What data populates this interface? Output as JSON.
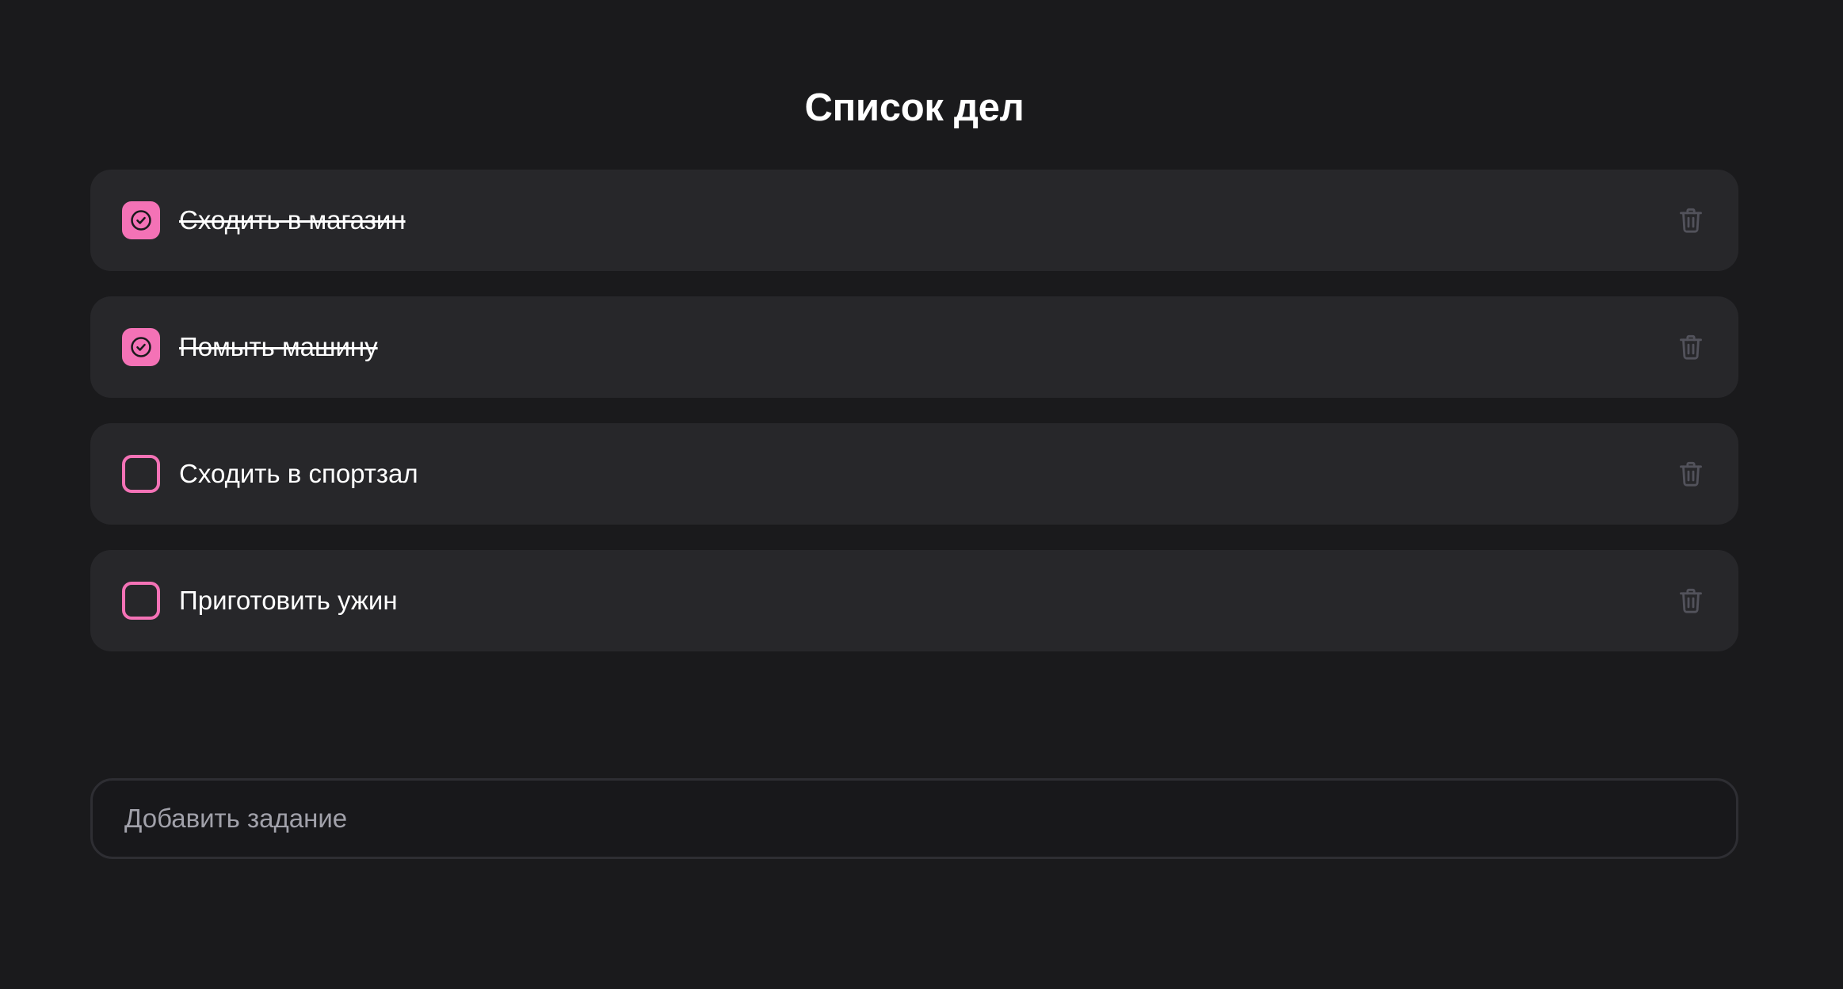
{
  "page": {
    "title": "Список дел"
  },
  "todos": [
    {
      "text": "Сходить в магазин",
      "done": true
    },
    {
      "text": "Помыть машину",
      "done": true
    },
    {
      "text": "Сходить в спортзал",
      "done": false
    },
    {
      "text": "Приготовить ужин",
      "done": false
    }
  ],
  "new_task": {
    "placeholder": "Добавить задание",
    "value": ""
  },
  "icons": {
    "checkbox_checked": "check-circle-icon",
    "delete": "trash-icon"
  },
  "colors": {
    "background": "#1a1a1c",
    "card": "#27272a",
    "accent": "#f472b6",
    "text": "#ffffff",
    "muted_icon": "#52525b",
    "placeholder": "#a1a1aa",
    "input_border": "#2e2e33"
  }
}
